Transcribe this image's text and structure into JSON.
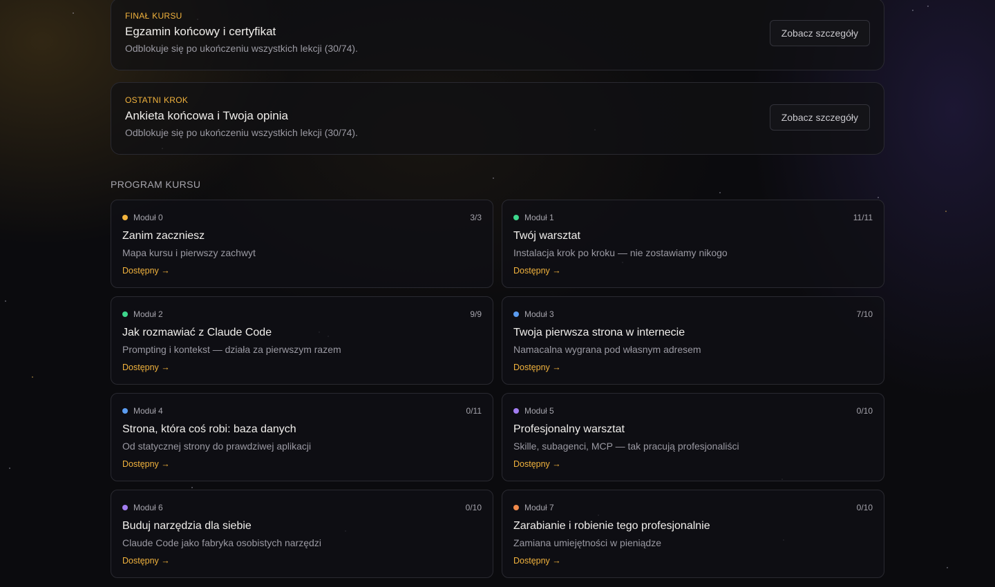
{
  "final_cards": [
    {
      "tag": "Finał kursu",
      "title": "Egzamin końcowy i certyfikat",
      "description": "Odblokuje się po ukończeniu wszystkich lekcji (30/74).",
      "button_label": "Zobacz szczegóły"
    },
    {
      "tag": "Ostatni krok",
      "title": "Ankieta końcowa i Twoja opinia",
      "description": "Odblokuje się po ukończeniu wszystkich lekcji (30/74).",
      "button_label": "Zobacz szczegóły"
    }
  ],
  "program": {
    "label": "PROGRAM KURSU",
    "modules": [
      {
        "module": "Moduł 0",
        "count": "3/3",
        "title": "Zanim zaczniesz",
        "subtitle": "Mapa kursu i pierwszy zachwyt",
        "status": "Dostępny →",
        "dot_color": "#f2b33d"
      },
      {
        "module": "Moduł 1",
        "count": "11/11",
        "title": "Twój warsztat",
        "subtitle": "Instalacja krok po kroku — nie zostawiamy nikogo",
        "status": "Dostępny →",
        "dot_color": "#3dd68c"
      },
      {
        "module": "Moduł 2",
        "count": "9/9",
        "title": "Jak rozmawiać z Claude Code",
        "subtitle": "Prompting i kontekst — działa za pierwszym razem",
        "status": "Dostępny →",
        "dot_color": "#3dd68c"
      },
      {
        "module": "Moduł 3",
        "count": "7/10",
        "title": "Twoja pierwsza strona w internecie",
        "subtitle": "Namacalna wygrana pod własnym adresem",
        "status": "Dostępny →",
        "dot_color": "#5b9cf0"
      },
      {
        "module": "Moduł 4",
        "count": "0/11",
        "title": "Strona, która coś robi: baza danych",
        "subtitle": "Od statycznej strony do prawdziwej aplikacji",
        "status": "Dostępny →",
        "dot_color": "#5b9cf0"
      },
      {
        "module": "Moduł 5",
        "count": "0/10",
        "title": "Profesjonalny warsztat",
        "subtitle": "Skille, subagenci, MCP — tak pracują profesjonaliści",
        "status": "Dostępny →",
        "dot_color": "#a27df0"
      },
      {
        "module": "Moduł 6",
        "count": "0/10",
        "title": "Buduj narzędzia dla siebie",
        "subtitle": "Claude Code jako fabryka osobistych narzędzi",
        "status": "Dostępny →",
        "dot_color": "#a27df0"
      },
      {
        "module": "Moduł 7",
        "count": "0/10",
        "title": "Zarabianie i robienie tego profesjonalnie",
        "subtitle": "Zamiana umiejętności w pieniądze",
        "status": "Dostępny →",
        "dot_color": "#f08a4b"
      }
    ]
  }
}
